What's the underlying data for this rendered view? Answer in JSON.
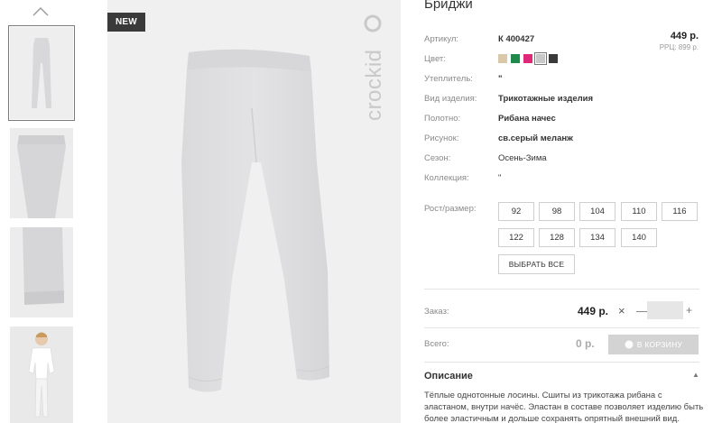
{
  "badge": "NEW",
  "brand_logo": "crockid",
  "product": {
    "title": "Бриджи",
    "price": "449 р.",
    "rrp": "РРЦ: 899 р.",
    "attributes": [
      {
        "label": "Артикул:",
        "value": "К 400427"
      },
      {
        "label": "Цвет:",
        "value": ""
      },
      {
        "label": "Утеплитель:",
        "value": "\""
      },
      {
        "label": "Вид изделия:",
        "value": "Трикотажные изделия"
      },
      {
        "label": "Полотно:",
        "value": "Рибана начес"
      },
      {
        "label": "Рисунок:",
        "value": "св.серый меланж"
      },
      {
        "label": "Сезон:",
        "value": "Осень-Зима"
      },
      {
        "label": "Коллекция:",
        "value": "\""
      }
    ],
    "colors": [
      "#d9c9a8",
      "#1f8a4c",
      "#e0287a",
      "#c8c8c8",
      "#3a3a3a"
    ],
    "selected_color_index": 3
  },
  "sizes": {
    "label": "Рост/размер:",
    "options": [
      "92",
      "98",
      "104",
      "110",
      "116",
      "122",
      "128",
      "134",
      "140"
    ],
    "select_all": "ВЫБРАТЬ ВСЕ"
  },
  "order": {
    "label": "Заказ:",
    "price": "449 р.",
    "times": "×",
    "minus": "—",
    "qty_value": "",
    "plus": "+"
  },
  "total": {
    "label": "Всего:",
    "value": "0 р.",
    "cart_button": "В КОРЗИНУ"
  },
  "description": {
    "title": "Описание",
    "text": "Тёплые однотонные лосины. Сшиты из трикотажа рибана с эластаном, внутри начёс. Эластан в составе позволяет изделию быть более эластичным и дольше сохранять опрятный внешний вид."
  }
}
